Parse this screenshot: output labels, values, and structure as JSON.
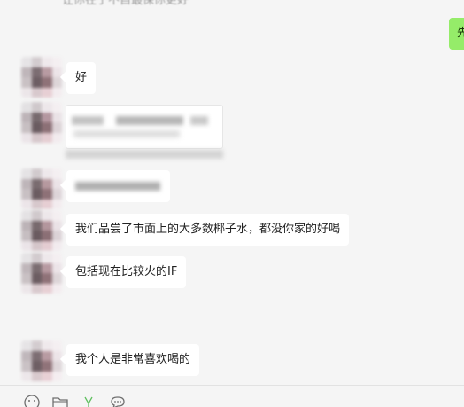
{
  "messages": {
    "top_fragment": "让你在于不自最保你更好",
    "outgoing_partial": "先",
    "m1": "好",
    "m4": "我们品尝了市面上的大多数椰子水，都没你家的好喝",
    "m5": "包括现在比较火的IF",
    "m6": "我个人是非常喜欢喝的"
  },
  "toolbar": {
    "icons": [
      "emoji-icon",
      "folder-icon",
      "screenshot-icon",
      "chat-history-icon"
    ]
  }
}
